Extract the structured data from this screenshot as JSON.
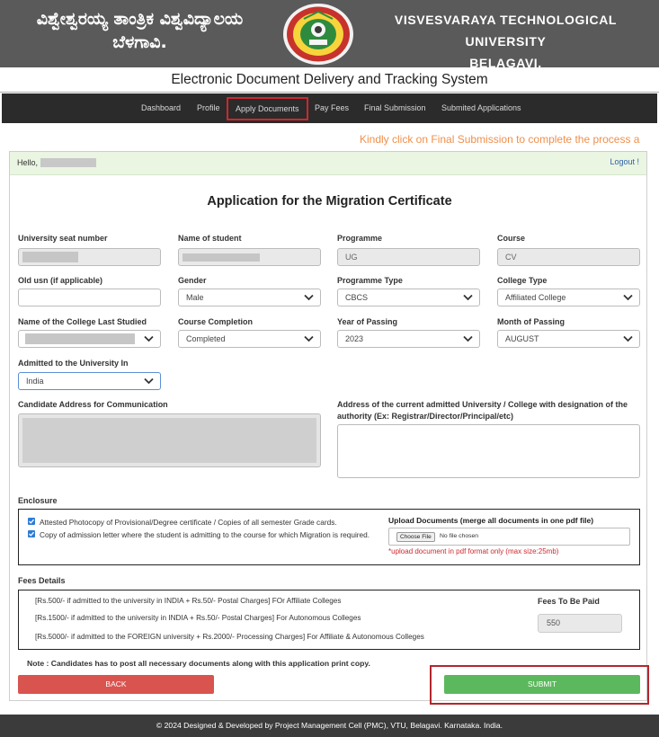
{
  "header": {
    "title_kn_line1": "ವಿಶ್ವೇಶ್ವರಯ್ಯ ತಾಂತ್ರಿಕ ವಿಶ್ವವಿದ್ಯಾಲಯ",
    "title_kn_line2": "ಬೆಳಗಾವಿ.",
    "title_en_line1": "VISVESVARAYA TECHNOLOGICAL UNIVERSITY",
    "title_en_line2": "BELAGAVI.",
    "system_title": "Electronic Document Delivery and Tracking System"
  },
  "nav": {
    "items": [
      "Dashboard",
      "Profile",
      "Apply Documents",
      "Pay Fees",
      "Final Submission",
      "Submited Applications"
    ],
    "active": "Apply Documents"
  },
  "marquee": "Kindly click on Final Submission to complete the process a",
  "greeting": {
    "hello": "Hello,",
    "logout": "Logout !"
  },
  "form": {
    "title": "Application for the Migration Certificate",
    "university_seat_number": {
      "label": "University seat number"
    },
    "name_of_student": {
      "label": "Name of student"
    },
    "programme": {
      "label": "Programme",
      "value": "UG"
    },
    "course": {
      "label": "Course",
      "value": "CV"
    },
    "old_usn": {
      "label": "Old usn (if applicable)",
      "value": ""
    },
    "gender": {
      "label": "Gender",
      "value": "Male"
    },
    "programme_type": {
      "label": "Programme Type",
      "value": "CBCS"
    },
    "college_type": {
      "label": "College Type",
      "value": "Affiliated College"
    },
    "college_last_studied": {
      "label": "Name of the College Last Studied"
    },
    "course_completion": {
      "label": "Course Completion",
      "value": "Completed"
    },
    "year_of_passing": {
      "label": "Year of Passing",
      "value": "2023"
    },
    "month_of_passing": {
      "label": "Month of Passing",
      "value": "AUGUST"
    },
    "admitted_to": {
      "label": "Admitted to the University In",
      "value": "India"
    },
    "candidate_address": {
      "label": "Candidate Address for Communication"
    },
    "current_university_address": {
      "label": "Address of the current admitted University / College with designation of the authority (Ex: Registrar/Director/Principal/etc)",
      "value": ""
    }
  },
  "enclosure": {
    "heading": "Enclosure",
    "items": [
      {
        "text": "Attested Photocopy of Provisional/Degree certificate / Copies of all semester Grade cards.",
        "checked": true
      },
      {
        "text": "Copy of admission letter where the student is admitting to the course for which Migration is required.",
        "checked": true
      }
    ],
    "upload_title": "Upload Documents (merge all documents in one pdf file)",
    "choose_file": "Choose File",
    "no_file": "No file chosen",
    "hint": "*upload document in pdf format only (max size:25mb)"
  },
  "fees": {
    "heading": "Fees Details",
    "lines": [
      "[Rs.500/- if admitted to the university in INDIA + Rs.50/- Postal Charges] FOr Affiliate Colleges",
      "[Rs.1500/- if admitted to the university in INDIA + Rs.50/- Postal Charges] For Autonomous Colleges",
      "[Rs.5000/- if admitted to the FOREIGN university + Rs.2000/- Processing Charges] For Affiliate & Autonomous Colleges"
    ],
    "to_be_paid_label": "Fees To Be Paid",
    "to_be_paid_value": "550"
  },
  "note": "Note : Candidates has to post all necessary documents along with this application print copy.",
  "buttons": {
    "back": "BACK",
    "submit": "SUBMIT"
  },
  "footer": "© 2024 Designed & Developed by Project Management Cell (PMC), VTU, Belagavi. Karnataka. India.",
  "colors": {
    "header_bg": "#5a5a5a",
    "nav_bg": "#2b2b2b",
    "highlight": "#d0272e",
    "back": "#d9534f",
    "submit": "#5cb85c",
    "marquee": "#f08f4c"
  }
}
